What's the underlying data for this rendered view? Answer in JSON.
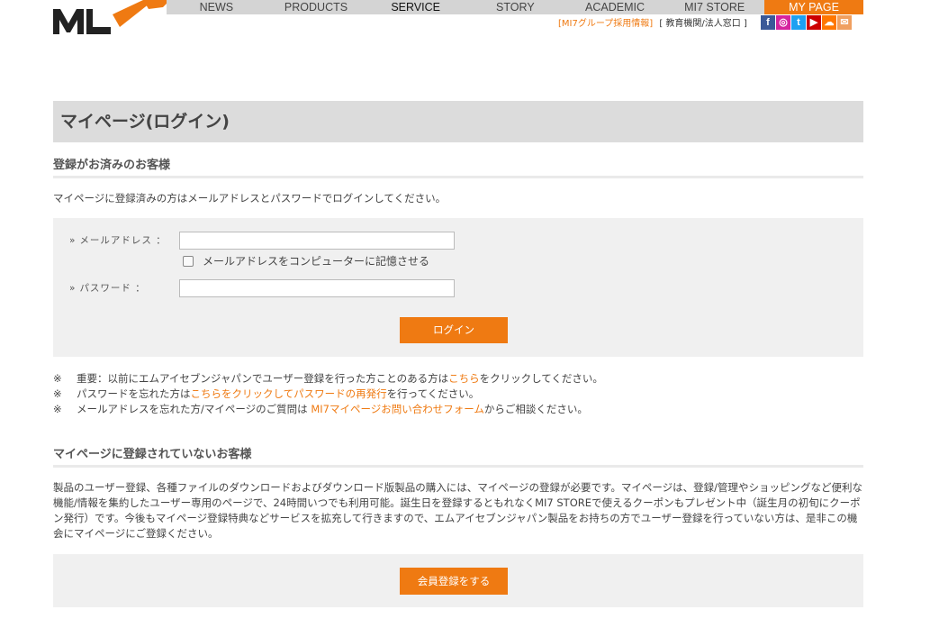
{
  "header": {
    "nav": [
      "NEWS",
      "PRODUCTS",
      "SERVICE",
      "STORY",
      "ACADEMIC",
      "MI7 STORE",
      "MY PAGE"
    ],
    "recruit_link": "[MI7グループ採用情報]",
    "edu_link": "[ 教育機関/法人窓口 ]",
    "social_icons": [
      "facebook-icon",
      "instagram-icon",
      "twitter-icon",
      "youtube-icon",
      "soundcloud-icon",
      "mail-icon"
    ],
    "accent_color": "#ef7a12"
  },
  "page": {
    "title": "マイページ(ログイン)"
  },
  "registered": {
    "heading": "登録がお済みのお客様",
    "intro": "マイページに登録済みの方はメールアドレスとパスワードでログインしてください。",
    "email_label": "メールアドレス ：",
    "email_value": "",
    "remember_label": "メールアドレスをコンピューターに記憶させる",
    "password_label": "パスワード ：",
    "password_value": "",
    "login_button": "ログイン"
  },
  "notes": {
    "mark": "※",
    "note1_before": "重要：以前にエムアイセブンジャパンでユーザー登録を行った方ことのある方は",
    "note1_link": "こちら",
    "note1_after": "をクリックしてください。",
    "note2_before": "パスワードを忘れた方は",
    "note2_link": "こちらをクリックしてパスワードの再発行",
    "note2_after": "を行ってください。",
    "note3_before": "メールアドレスを忘れた方/マイページのご質問は ",
    "note3_link": "MI7マイページお問い合わせフォーム",
    "note3_after": "からご相談ください。"
  },
  "unregistered": {
    "heading": "マイページに登録されていないお客様",
    "description": "製品のユーザー登録、各種ファイルのダウンロードおよびダウンロード版製品の購入には、マイページの登録が必要です。マイページは、登録/管理やショッピングなど便利な機能/情報を集約したユーザー専用のページで、24時間いつでも利用可能。誕生日を登録するともれなくMI7 STOREで使えるクーポンもプレゼント中（誕生月の初旬にクーポン発行）です。今後もマイページ登録特典などサービスを拡充して行きますので、エムアイセブンジャパン製品をお持ちの方でユーザー登録を行っていない方は、是非この機会にマイページにご登録ください。",
    "register_button": "会員登録をする"
  }
}
